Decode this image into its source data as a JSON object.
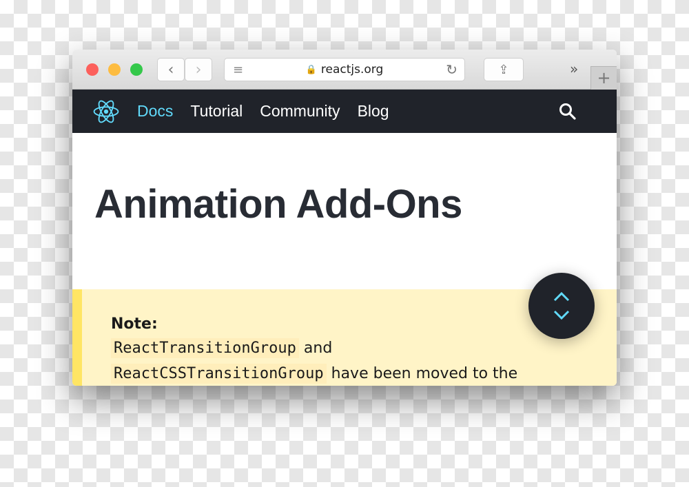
{
  "browser": {
    "url": "reactjs.org",
    "overflow_label": "»",
    "new_tab_label": "+"
  },
  "nav": {
    "items": [
      {
        "label": "Docs",
        "active": true
      },
      {
        "label": "Tutorial"
      },
      {
        "label": "Community"
      },
      {
        "label": "Blog"
      }
    ],
    "accent": "#61dafb"
  },
  "page": {
    "title": "Animation Add-Ons"
  },
  "note": {
    "heading": "Note:",
    "code1": "ReactTransitionGroup",
    "text1": " and",
    "code2": "ReactCSSTransitionGroup",
    "text2": " have been moved to the"
  },
  "fab": {
    "up": "⌃",
    "down": "⌄"
  }
}
